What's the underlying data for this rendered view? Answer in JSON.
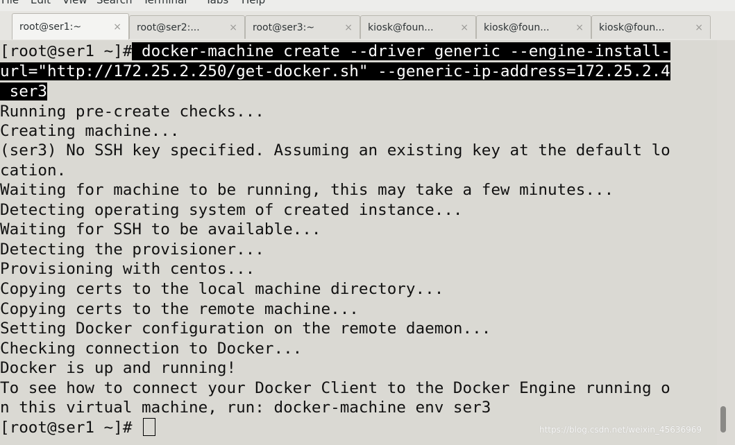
{
  "menubar": {
    "items": [
      "File",
      "Edit",
      "View",
      "Search",
      "Terminal",
      "Tabs",
      "Help"
    ]
  },
  "tabs": [
    {
      "label": "root@ser1:~",
      "active": true
    },
    {
      "label": "root@ser2:...",
      "active": false
    },
    {
      "label": "root@ser3:~",
      "active": false
    },
    {
      "label": "kiosk@foun...",
      "active": false
    },
    {
      "label": "kiosk@foun...",
      "active": false
    },
    {
      "label": "kiosk@foun...",
      "active": false
    }
  ],
  "tab_close_glyph": "×",
  "terminal": {
    "prompt": "[root@ser1 ~]#",
    "command_lines": [
      " docker-machine create --driver generic --engine-install-",
      "url=\"http://172.25.2.250/get-docker.sh\" --generic-ip-address=172.25.2.4",
      " ser3"
    ],
    "output_lines": [
      "Running pre-create checks...",
      "Creating machine...",
      "(ser3) No SSH key specified. Assuming an existing key at the default lo",
      "cation.",
      "Waiting for machine to be running, this may take a few minutes...",
      "Detecting operating system of created instance...",
      "Waiting for SSH to be available...",
      "Detecting the provisioner...",
      "Provisioning with centos...",
      "Copying certs to the local machine directory...",
      "Copying certs to the remote machine...",
      "Setting Docker configuration on the remote daemon...",
      "Checking connection to Docker...",
      "Docker is up and running!",
      "To see how to connect your Docker Client to the Docker Engine running o",
      "n this virtual machine, run: docker-machine env ser3"
    ],
    "final_prompt": "[root@ser1 ~]# "
  },
  "watermark": "https://blog.csdn.net/weixin_45636969",
  "colors": {
    "terminal_bg": "#dad9d3",
    "selection_bg": "#000000",
    "selection_fg": "#ffffff"
  }
}
